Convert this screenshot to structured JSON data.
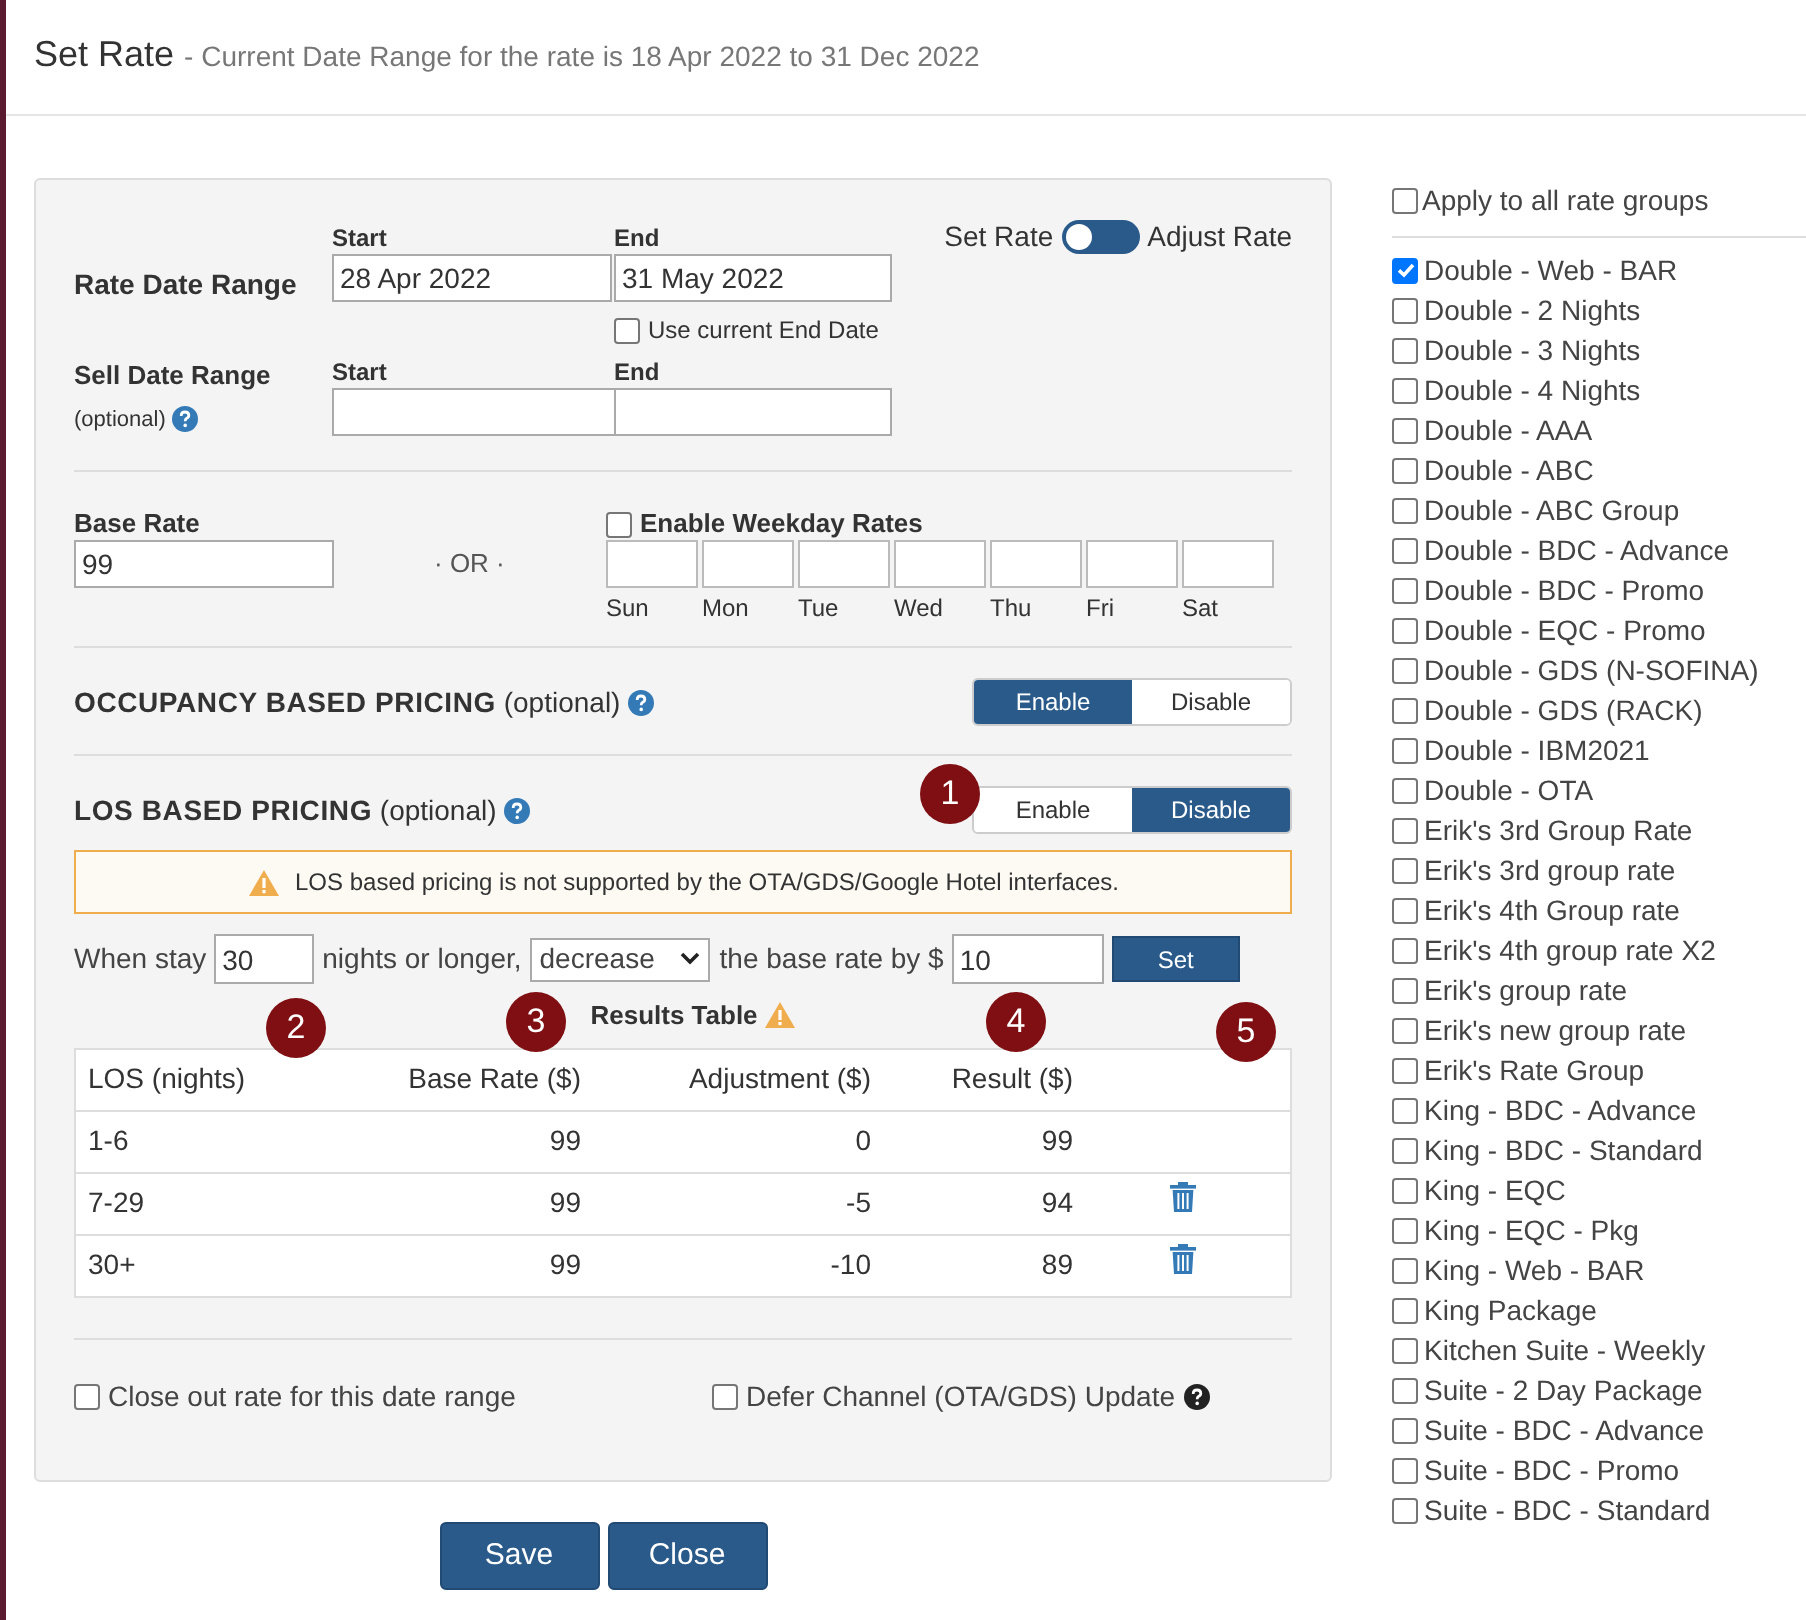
{
  "header": {
    "title": "Set Rate",
    "subtitle": "- Current Date Range for the rate is 18 Apr 2022 to 31 Dec 2022"
  },
  "rate_date_range": {
    "label": "Rate Date Range",
    "start_label": "Start",
    "start": "28 Apr 2022",
    "end_label": "End",
    "end": "31 May 2022",
    "use_current_end": {
      "label": "Use current End Date",
      "checked": false
    }
  },
  "mode_toggle": {
    "left_label": "Set Rate",
    "right_label": "Adjust Rate",
    "on": false
  },
  "sell_date_range": {
    "label": "Sell Date Range",
    "note": "(optional)",
    "start_label": "Start",
    "end_label": "End"
  },
  "base_rate": {
    "label": "Base Rate",
    "value": "99",
    "separator": "· OR ·"
  },
  "weekday_rates": {
    "label": "Enable Weekday Rates",
    "checked": false,
    "days": [
      "Sun",
      "Mon",
      "Tue",
      "Wed",
      "Thu",
      "Fri",
      "Sat"
    ]
  },
  "occupancy": {
    "title": "OCCUPANCY BASED PRICING",
    "note": "(optional)",
    "options": [
      {
        "label": "Enable",
        "selected": true
      },
      {
        "label": "Disable",
        "selected": false
      }
    ]
  },
  "los": {
    "title": "LOS BASED PRICING",
    "note": "(optional)",
    "options": [
      {
        "label": "Enable",
        "selected": false
      },
      {
        "label": "Disable",
        "selected": true
      }
    ],
    "warning": "LOS based pricing is not supported by the OTA/GDS/Google Hotel interfaces.",
    "rule": {
      "prefix": "When stay",
      "nights": "30",
      "middle": "nights or longer,",
      "direction": "decrease",
      "suffix": "the base rate by $",
      "amount": "10",
      "button": "Set"
    },
    "results_title": "Results Table",
    "table": {
      "columns": [
        "LOS (nights)",
        "Base Rate ($)",
        "Adjustment ($)",
        "Result ($)"
      ],
      "rows": [
        {
          "cells": [
            "1-6",
            "99",
            "0",
            "99"
          ],
          "deletable": false
        },
        {
          "cells": [
            "7-29",
            "99",
            "-5",
            "94"
          ],
          "deletable": true
        },
        {
          "cells": [
            "30+",
            "99",
            "-10",
            "89"
          ],
          "deletable": true
        }
      ]
    }
  },
  "markers": [
    "1",
    "2",
    "3",
    "4",
    "5"
  ],
  "footer_options": [
    {
      "label": "Close out rate for this date range",
      "checked": false,
      "help": false
    },
    {
      "label": "Defer Channel (OTA/GDS) Update",
      "checked": false,
      "help": true
    }
  ],
  "buttons": [
    "Save",
    "Close"
  ],
  "rate_groups": {
    "apply_all": {
      "label": "Apply to all rate groups",
      "checked": false
    },
    "items": [
      {
        "label": "Double - Web - BAR",
        "checked": true
      },
      {
        "label": "Double - 2 Nights",
        "checked": false
      },
      {
        "label": "Double - 3 Nights",
        "checked": false
      },
      {
        "label": "Double - 4 Nights",
        "checked": false
      },
      {
        "label": "Double - AAA",
        "checked": false
      },
      {
        "label": "Double - ABC",
        "checked": false
      },
      {
        "label": "Double - ABC Group",
        "checked": false
      },
      {
        "label": "Double - BDC - Advance",
        "checked": false
      },
      {
        "label": "Double - BDC - Promo",
        "checked": false
      },
      {
        "label": "Double - EQC - Promo",
        "checked": false
      },
      {
        "label": "Double - GDS (N-SOFINA)",
        "checked": false
      },
      {
        "label": "Double - GDS (RACK)",
        "checked": false
      },
      {
        "label": "Double - IBM2021",
        "checked": false
      },
      {
        "label": "Double - OTA",
        "checked": false
      },
      {
        "label": "Erik's 3rd Group Rate",
        "checked": false
      },
      {
        "label": "Erik's 3rd group rate",
        "checked": false
      },
      {
        "label": "Erik's 4th Group rate",
        "checked": false
      },
      {
        "label": "Erik's 4th group rate X2",
        "checked": false
      },
      {
        "label": "Erik's group rate",
        "checked": false
      },
      {
        "label": "Erik's new group rate",
        "checked": false
      },
      {
        "label": "Erik's Rate Group",
        "checked": false
      },
      {
        "label": "King - BDC - Advance",
        "checked": false
      },
      {
        "label": "King - BDC - Standard",
        "checked": false
      },
      {
        "label": "King - EQC",
        "checked": false
      },
      {
        "label": "King - EQC - Pkg",
        "checked": false
      },
      {
        "label": "King - Web - BAR",
        "checked": false
      },
      {
        "label": "King Package",
        "checked": false
      },
      {
        "label": "Kitchen Suite - Weekly",
        "checked": false
      },
      {
        "label": "Suite - 2 Day Package",
        "checked": false
      },
      {
        "label": "Suite - BDC - Advance",
        "checked": false
      },
      {
        "label": "Suite - BDC - Promo",
        "checked": false
      },
      {
        "label": "Suite - BDC - Standard",
        "checked": false
      }
    ]
  }
}
